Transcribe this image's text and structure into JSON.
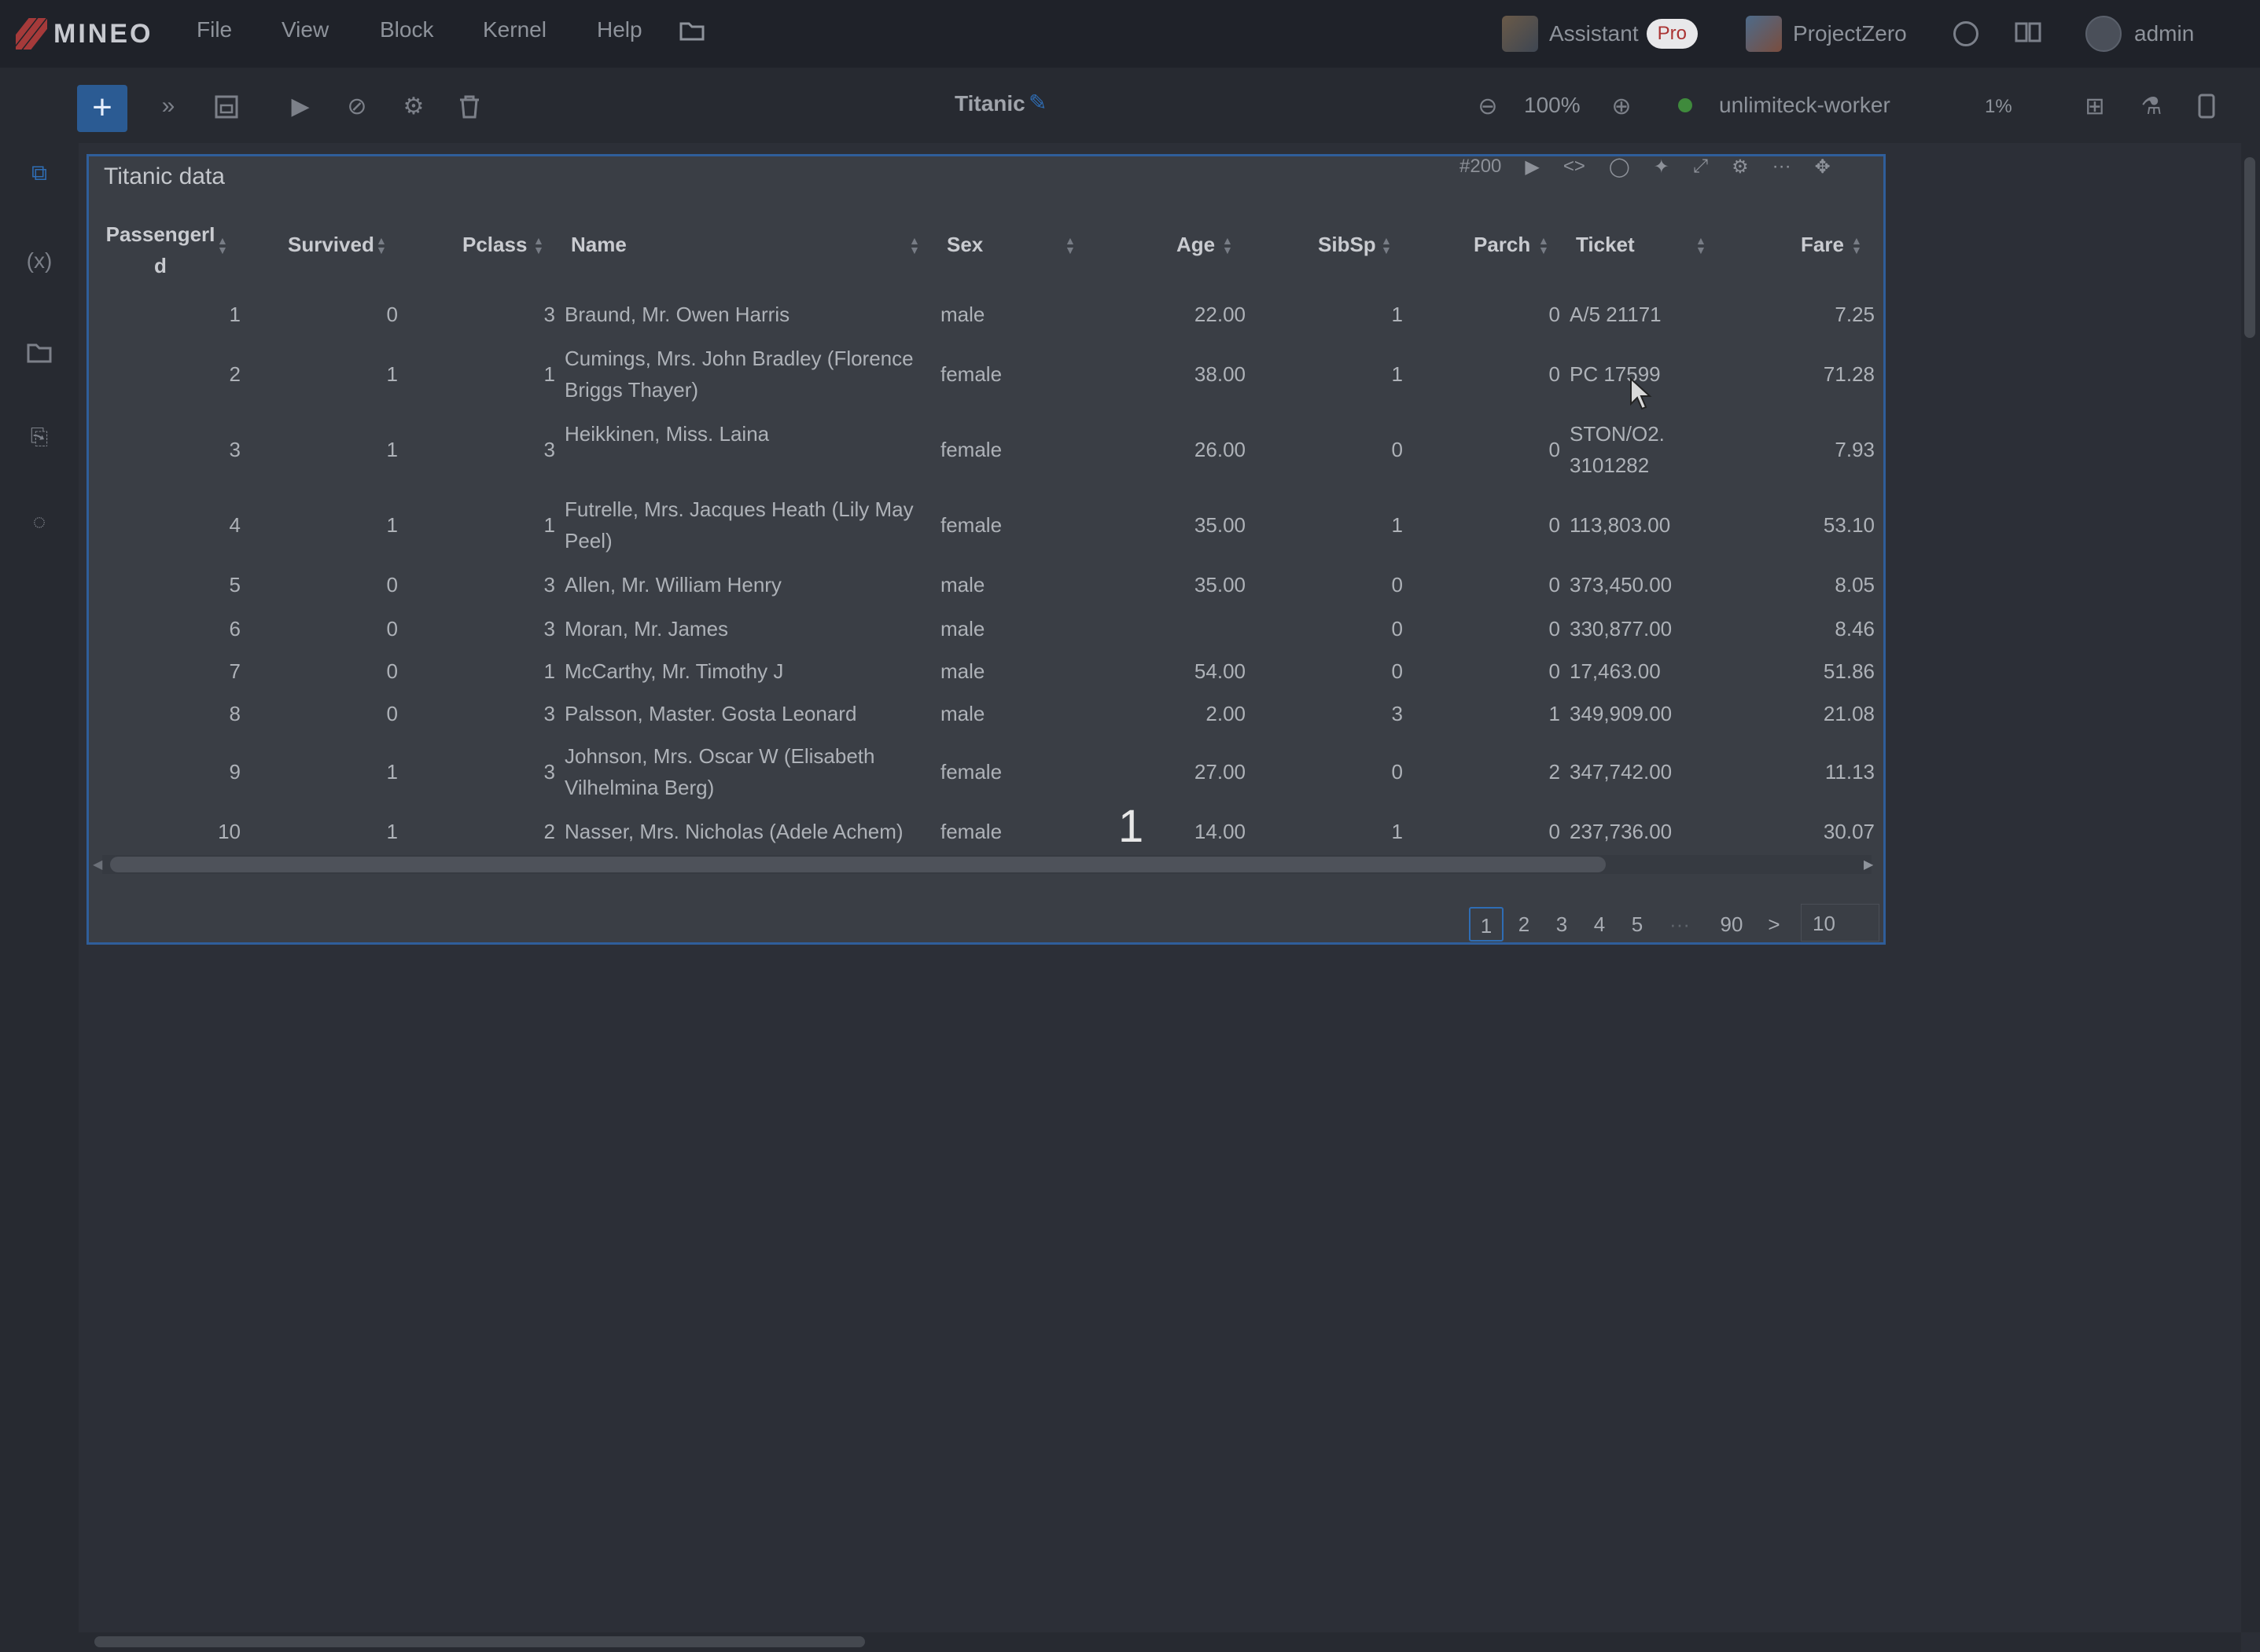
{
  "app": {
    "logo_text": "MINEO",
    "notebook_title": "Titanic",
    "zoom": "100%",
    "worker": "unlimiteck-worker",
    "worker_usage": "1%"
  },
  "menu": {
    "file": "File",
    "view": "View",
    "block": "Block",
    "kernel": "Kernel",
    "help": "Help"
  },
  "header_right": {
    "assistant": "Assistant",
    "pro": "Pro",
    "project": "ProjectZero",
    "user": "admin"
  },
  "block": {
    "title": "Titanic data",
    "id": "#200"
  },
  "table": {
    "columns": [
      "PassengerId",
      "Survived",
      "Pclass",
      "Name",
      "Sex",
      "Age",
      "SibSp",
      "Parch",
      "Ticket",
      "Fare"
    ],
    "passengerid_head_1": "PassengerI",
    "passengerid_head_2": "d",
    "rows": [
      {
        "id": "1",
        "survived": "0",
        "pclass": "3",
        "name1": "Braund, Mr. Owen Harris",
        "name2": "",
        "sex": "male",
        "age": "22.00",
        "sibsp": "1",
        "parch": "0",
        "ticket1": "A/5 21171",
        "ticket2": "",
        "fare": "7.25"
      },
      {
        "id": "2",
        "survived": "1",
        "pclass": "1",
        "name1": "Cumings, Mrs. John Bradley (Florence",
        "name2": "Briggs Thayer)",
        "sex": "female",
        "age": "38.00",
        "sibsp": "1",
        "parch": "0",
        "ticket1": "PC 17599",
        "ticket2": "",
        "fare": "71.28"
      },
      {
        "id": "3",
        "survived": "1",
        "pclass": "3",
        "name1": "Heikkinen, Miss. Laina",
        "name2": "",
        "sex": "female",
        "age": "26.00",
        "sibsp": "0",
        "parch": "0",
        "ticket1": "STON/O2.",
        "ticket2": "3101282",
        "fare": "7.93"
      },
      {
        "id": "4",
        "survived": "1",
        "pclass": "1",
        "name1": "Futrelle, Mrs. Jacques Heath (Lily May",
        "name2": "Peel)",
        "sex": "female",
        "age": "35.00",
        "sibsp": "1",
        "parch": "0",
        "ticket1": "113,803.00",
        "ticket2": "",
        "fare": "53.10"
      },
      {
        "id": "5",
        "survived": "0",
        "pclass": "3",
        "name1": "Allen, Mr. William Henry",
        "name2": "",
        "sex": "male",
        "age": "35.00",
        "sibsp": "0",
        "parch": "0",
        "ticket1": "373,450.00",
        "ticket2": "",
        "fare": "8.05"
      },
      {
        "id": "6",
        "survived": "0",
        "pclass": "3",
        "name1": "Moran, Mr. James",
        "name2": "",
        "sex": "male",
        "age": "",
        "sibsp": "0",
        "parch": "0",
        "ticket1": "330,877.00",
        "ticket2": "",
        "fare": "8.46"
      },
      {
        "id": "7",
        "survived": "0",
        "pclass": "1",
        "name1": "McCarthy, Mr. Timothy J",
        "name2": "",
        "sex": "male",
        "age": "54.00",
        "sibsp": "0",
        "parch": "0",
        "ticket1": "17,463.00",
        "ticket2": "",
        "fare": "51.86"
      },
      {
        "id": "8",
        "survived": "0",
        "pclass": "3",
        "name1": "Palsson, Master. Gosta Leonard",
        "name2": "",
        "sex": "male",
        "age": "2.00",
        "sibsp": "3",
        "parch": "1",
        "ticket1": "349,909.00",
        "ticket2": "",
        "fare": "21.08"
      },
      {
        "id": "9",
        "survived": "1",
        "pclass": "3",
        "name1": "Johnson, Mrs. Oscar W (Elisabeth",
        "name2": "Vilhelmina Berg)",
        "sex": "female",
        "age": "27.00",
        "sibsp": "0",
        "parch": "2",
        "ticket1": "347,742.00",
        "ticket2": "",
        "fare": "11.13"
      },
      {
        "id": "10",
        "survived": "1",
        "pclass": "2",
        "name1": "Nasser, Mrs. Nicholas (Adele Achem)",
        "name2": "",
        "sex": "female",
        "age": "14.00",
        "sibsp": "1",
        "parch": "0",
        "ticket1": "237,736.00",
        "ticket2": "",
        "fare": "30.07"
      }
    ]
  },
  "pagination": {
    "pages": [
      "1",
      "2",
      "3",
      "4",
      "5"
    ],
    "ellipsis": "···",
    "last": "90",
    "next": ">",
    "page_size": "10",
    "current": "1"
  },
  "overlay": {
    "step_number": "1"
  },
  "colors": {
    "accent": "#2f6db4",
    "topbar": "#1f2229",
    "block_bg": "#3a3e45"
  }
}
